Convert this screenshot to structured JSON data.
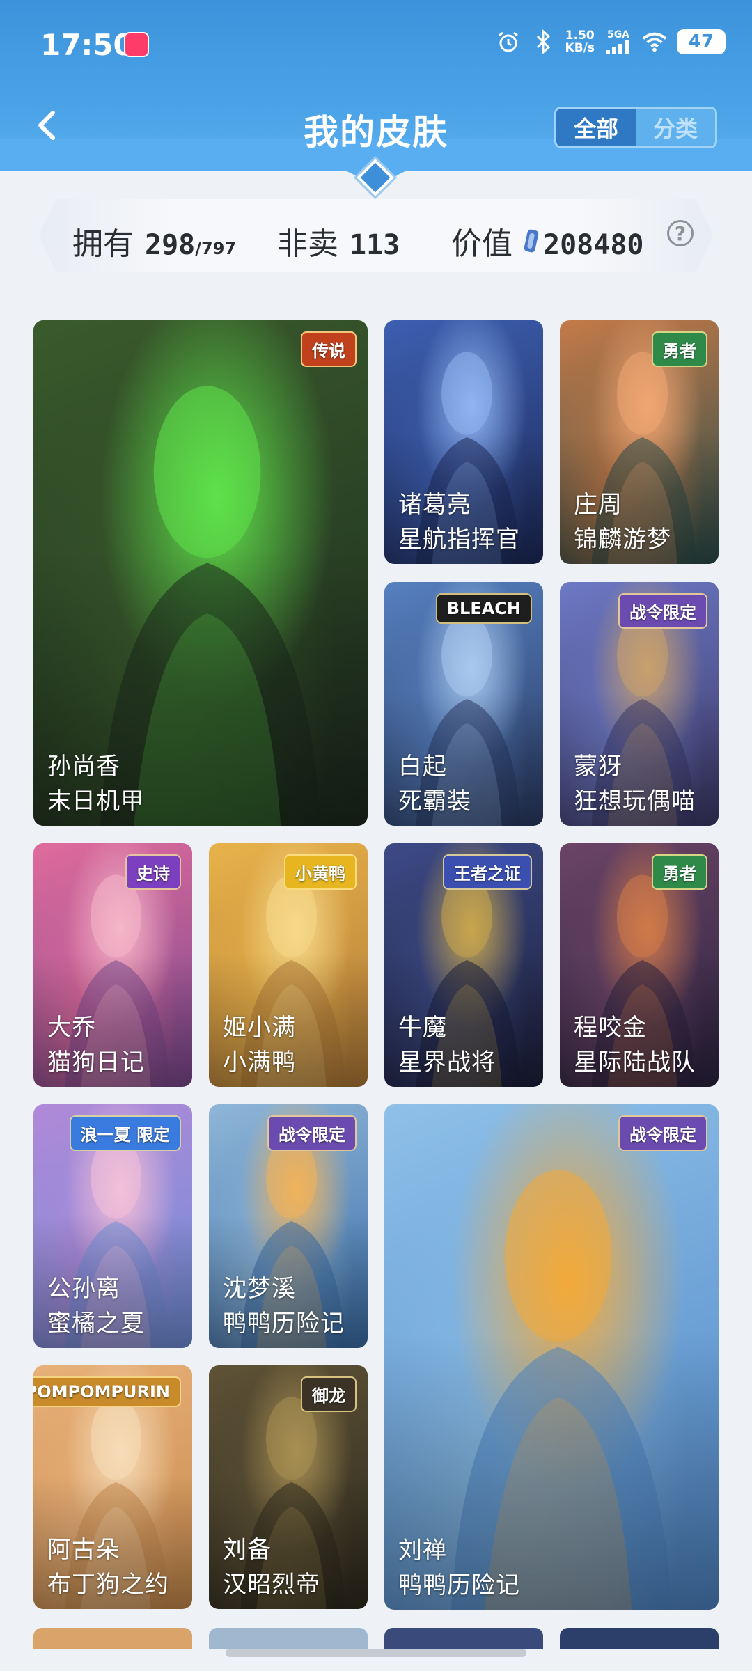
{
  "status_bar": {
    "time": "17:50",
    "net_speed_value": "1.50",
    "net_speed_unit": "KB/s",
    "signal_label": "5GA",
    "battery": "47"
  },
  "header": {
    "title": "我的皮肤",
    "segments": [
      "全部",
      "分类"
    ],
    "active_segment": "全部"
  },
  "stats": {
    "owned_label": "拥有",
    "owned_value": "298",
    "owned_total": "/797",
    "not_for_sale_label": "非卖",
    "not_for_sale_value": "113",
    "value_label": "价值",
    "value_amount": "208480",
    "help_symbol": "?"
  },
  "skins": [
    {
      "hero": "孙尚香",
      "skin": "末日机甲",
      "badge": "传说",
      "palette": [
        "#1c2a1e",
        "#3a5b2c",
        "#5fe14a"
      ],
      "badge_color": "#c2411d"
    },
    {
      "hero": "诸葛亮",
      "skin": "星航指挥官",
      "badge": "",
      "palette": [
        "#1d2a5b",
        "#3d5fb0",
        "#8fb4f0"
      ],
      "badge_color": ""
    },
    {
      "hero": "庄周",
      "skin": "锦麟游梦",
      "badge": "勇者",
      "palette": [
        "#2b4d4a",
        "#c47a48",
        "#f0a673"
      ],
      "badge_color": "#2f8a4a"
    },
    {
      "hero": "白起",
      "skin": "死霸装",
      "badge": "BLEACH",
      "palette": [
        "#2a3b64",
        "#5680bf",
        "#a9c9ef"
      ],
      "badge_color": "#1e1e1e"
    },
    {
      "hero": "蒙犽",
      "skin": "狂想玩偶喵",
      "badge": "战令限定",
      "palette": [
        "#3d3a6a",
        "#6d79c4",
        "#c8a06b"
      ],
      "badge_color": "#6b4bb0"
    },
    {
      "hero": "大乔",
      "skin": "猫狗日记",
      "badge": "史诗",
      "palette": [
        "#7c4a8f",
        "#e06b9c",
        "#f4b6c8"
      ],
      "badge_color": "#7b3fbf"
    },
    {
      "hero": "姬小满",
      "skin": "小满鸭",
      "badge": "小黄鸭",
      "palette": [
        "#b07a38",
        "#e8b24a",
        "#f6d98a"
      ],
      "badge_color": "#e6b520"
    },
    {
      "hero": "牛魔",
      "skin": "星界战将",
      "badge": "王者之证",
      "palette": [
        "#1b1f3a",
        "#3d4a86",
        "#c8a64d"
      ],
      "badge_color": "#3a4fb0"
    },
    {
      "hero": "程咬金",
      "skin": "星际陆战队",
      "badge": "勇者",
      "palette": [
        "#2b2340",
        "#6b4466",
        "#d07a48"
      ],
      "badge_color": "#2f8a4a"
    },
    {
      "hero": "公孙离",
      "skin": "蜜橘之夏",
      "badge": "浪一夏 限定",
      "palette": [
        "#6f8fd8",
        "#b189d8",
        "#f3c0d8"
      ],
      "badge_color": "#3a7be0"
    },
    {
      "hero": "沈梦溪",
      "skin": "鸭鸭历险记",
      "badge": "战令限定",
      "palette": [
        "#3b6ea8",
        "#8fb6d8",
        "#f0b25a"
      ],
      "badge_color": "#6b4bb0"
    },
    {
      "hero": "刘禅",
      "skin": "鸭鸭历险记",
      "badge": "战令限定",
      "palette": [
        "#4f86c6",
        "#8ec0e8",
        "#f3a93a"
      ],
      "badge_color": "#6b4bb0"
    },
    {
      "hero": "阿古朵",
      "skin": "布丁狗之约",
      "badge": "POMPOMPURIN",
      "palette": [
        "#c78a4c",
        "#e8b07a",
        "#f6dcb8"
      ],
      "badge_color": "#c98a2a"
    },
    {
      "hero": "刘备",
      "skin": "汉昭烈帝",
      "badge": "御龙",
      "palette": [
        "#2e2a1e",
        "#5e5236",
        "#a88f52"
      ],
      "badge_color": "#3a3326"
    }
  ],
  "colors": {
    "header_blue": "#3c93db",
    "segment_active": "#2f78c4",
    "page_bg": "#eef1f6"
  }
}
